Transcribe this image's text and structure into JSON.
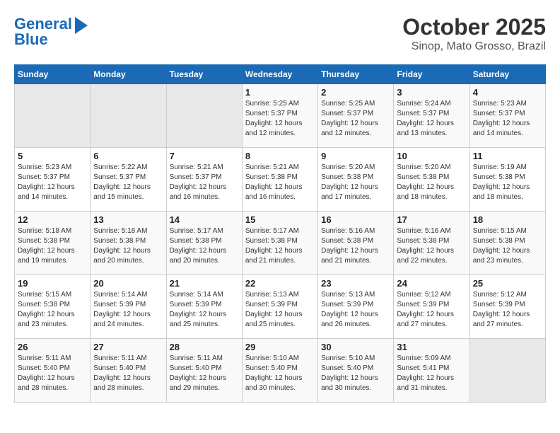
{
  "logo": {
    "line1": "General",
    "line2": "Blue"
  },
  "title": "October 2025",
  "subtitle": "Sinop, Mato Grosso, Brazil",
  "days_of_week": [
    "Sunday",
    "Monday",
    "Tuesday",
    "Wednesday",
    "Thursday",
    "Friday",
    "Saturday"
  ],
  "weeks": [
    [
      {
        "day": "",
        "info": ""
      },
      {
        "day": "",
        "info": ""
      },
      {
        "day": "",
        "info": ""
      },
      {
        "day": "1",
        "info": "Sunrise: 5:25 AM\nSunset: 5:37 PM\nDaylight: 12 hours\nand 12 minutes."
      },
      {
        "day": "2",
        "info": "Sunrise: 5:25 AM\nSunset: 5:37 PM\nDaylight: 12 hours\nand 12 minutes."
      },
      {
        "day": "3",
        "info": "Sunrise: 5:24 AM\nSunset: 5:37 PM\nDaylight: 12 hours\nand 13 minutes."
      },
      {
        "day": "4",
        "info": "Sunrise: 5:23 AM\nSunset: 5:37 PM\nDaylight: 12 hours\nand 14 minutes."
      }
    ],
    [
      {
        "day": "5",
        "info": "Sunrise: 5:23 AM\nSunset: 5:37 PM\nDaylight: 12 hours\nand 14 minutes."
      },
      {
        "day": "6",
        "info": "Sunrise: 5:22 AM\nSunset: 5:37 PM\nDaylight: 12 hours\nand 15 minutes."
      },
      {
        "day": "7",
        "info": "Sunrise: 5:21 AM\nSunset: 5:37 PM\nDaylight: 12 hours\nand 16 minutes."
      },
      {
        "day": "8",
        "info": "Sunrise: 5:21 AM\nSunset: 5:38 PM\nDaylight: 12 hours\nand 16 minutes."
      },
      {
        "day": "9",
        "info": "Sunrise: 5:20 AM\nSunset: 5:38 PM\nDaylight: 12 hours\nand 17 minutes."
      },
      {
        "day": "10",
        "info": "Sunrise: 5:20 AM\nSunset: 5:38 PM\nDaylight: 12 hours\nand 18 minutes."
      },
      {
        "day": "11",
        "info": "Sunrise: 5:19 AM\nSunset: 5:38 PM\nDaylight: 12 hours\nand 18 minutes."
      }
    ],
    [
      {
        "day": "12",
        "info": "Sunrise: 5:18 AM\nSunset: 5:38 PM\nDaylight: 12 hours\nand 19 minutes."
      },
      {
        "day": "13",
        "info": "Sunrise: 5:18 AM\nSunset: 5:38 PM\nDaylight: 12 hours\nand 20 minutes."
      },
      {
        "day": "14",
        "info": "Sunrise: 5:17 AM\nSunset: 5:38 PM\nDaylight: 12 hours\nand 20 minutes."
      },
      {
        "day": "15",
        "info": "Sunrise: 5:17 AM\nSunset: 5:38 PM\nDaylight: 12 hours\nand 21 minutes."
      },
      {
        "day": "16",
        "info": "Sunrise: 5:16 AM\nSunset: 5:38 PM\nDaylight: 12 hours\nand 21 minutes."
      },
      {
        "day": "17",
        "info": "Sunrise: 5:16 AM\nSunset: 5:38 PM\nDaylight: 12 hours\nand 22 minutes."
      },
      {
        "day": "18",
        "info": "Sunrise: 5:15 AM\nSunset: 5:38 PM\nDaylight: 12 hours\nand 23 minutes."
      }
    ],
    [
      {
        "day": "19",
        "info": "Sunrise: 5:15 AM\nSunset: 5:38 PM\nDaylight: 12 hours\nand 23 minutes."
      },
      {
        "day": "20",
        "info": "Sunrise: 5:14 AM\nSunset: 5:39 PM\nDaylight: 12 hours\nand 24 minutes."
      },
      {
        "day": "21",
        "info": "Sunrise: 5:14 AM\nSunset: 5:39 PM\nDaylight: 12 hours\nand 25 minutes."
      },
      {
        "day": "22",
        "info": "Sunrise: 5:13 AM\nSunset: 5:39 PM\nDaylight: 12 hours\nand 25 minutes."
      },
      {
        "day": "23",
        "info": "Sunrise: 5:13 AM\nSunset: 5:39 PM\nDaylight: 12 hours\nand 26 minutes."
      },
      {
        "day": "24",
        "info": "Sunrise: 5:12 AM\nSunset: 5:39 PM\nDaylight: 12 hours\nand 27 minutes."
      },
      {
        "day": "25",
        "info": "Sunrise: 5:12 AM\nSunset: 5:39 PM\nDaylight: 12 hours\nand 27 minutes."
      }
    ],
    [
      {
        "day": "26",
        "info": "Sunrise: 5:11 AM\nSunset: 5:40 PM\nDaylight: 12 hours\nand 28 minutes."
      },
      {
        "day": "27",
        "info": "Sunrise: 5:11 AM\nSunset: 5:40 PM\nDaylight: 12 hours\nand 28 minutes."
      },
      {
        "day": "28",
        "info": "Sunrise: 5:11 AM\nSunset: 5:40 PM\nDaylight: 12 hours\nand 29 minutes."
      },
      {
        "day": "29",
        "info": "Sunrise: 5:10 AM\nSunset: 5:40 PM\nDaylight: 12 hours\nand 30 minutes."
      },
      {
        "day": "30",
        "info": "Sunrise: 5:10 AM\nSunset: 5:40 PM\nDaylight: 12 hours\nand 30 minutes."
      },
      {
        "day": "31",
        "info": "Sunrise: 5:09 AM\nSunset: 5:41 PM\nDaylight: 12 hours\nand 31 minutes."
      },
      {
        "day": "",
        "info": ""
      }
    ]
  ]
}
